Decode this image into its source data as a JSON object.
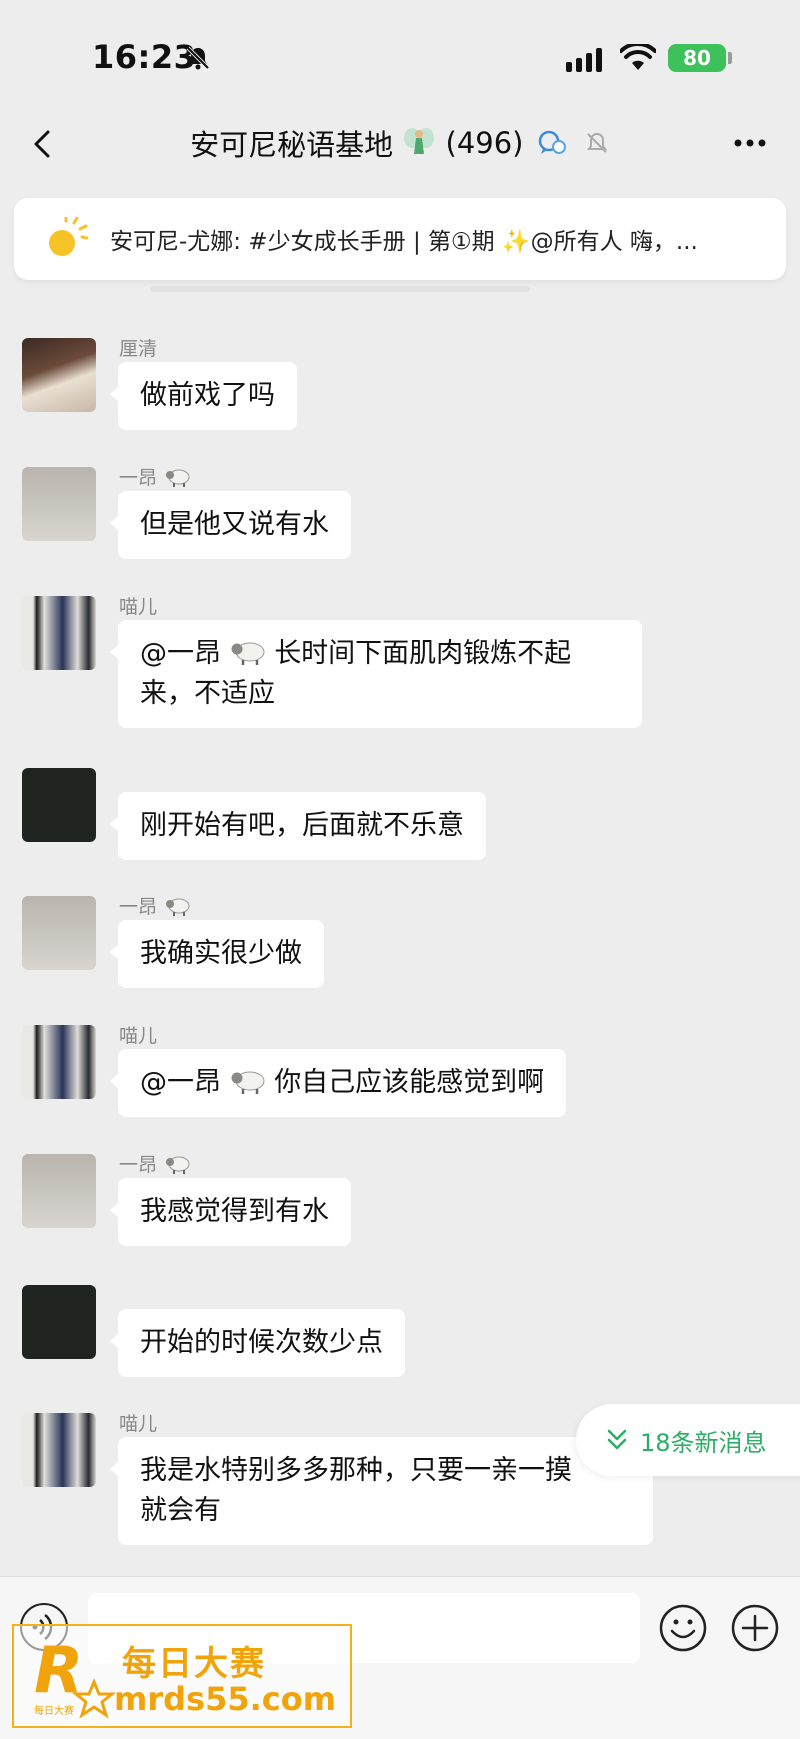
{
  "status_bar": {
    "time": "16:23",
    "battery": "80"
  },
  "header": {
    "title": "安可尼秘语基地",
    "member_count": "(496)"
  },
  "pinned": {
    "text": "安可尼-尤娜: #少女成长手册 | 第①期 ✨@所有人  嗨，..."
  },
  "messages": [
    {
      "sender": "厘清",
      "text": "做前戏了吗"
    },
    {
      "sender": "一昂",
      "text": "但是他又说有水"
    },
    {
      "sender": "喵儿",
      "mention": "@一昂",
      "text_line1": "长时间下面肌肉锻炼不起",
      "text_line2": "来，不适应"
    },
    {
      "sender": "",
      "text": "刚开始有吧，后面就不乐意"
    },
    {
      "sender": "一昂",
      "text": "我确实很少做"
    },
    {
      "sender": "喵儿",
      "mention": "@一昂",
      "text": "你自己应该能感觉到啊"
    },
    {
      "sender": "一昂",
      "text": "我感觉得到有水"
    },
    {
      "sender": "",
      "text": "开始的时候次数少点"
    },
    {
      "sender": "喵儿",
      "text_line1": "我是水特别多多那种，只要一亲一摸",
      "text_line2": "就会有"
    }
  ],
  "new_messages": {
    "label": "18条新消息"
  },
  "watermark": {
    "title": "每日大赛",
    "url": "mrds55.com",
    "logo_text": "每日大赛"
  },
  "colors": {
    "accent_green": "#2bae66",
    "battery_green": "#3dc15a",
    "watermark_orange": "#f0a30a"
  }
}
